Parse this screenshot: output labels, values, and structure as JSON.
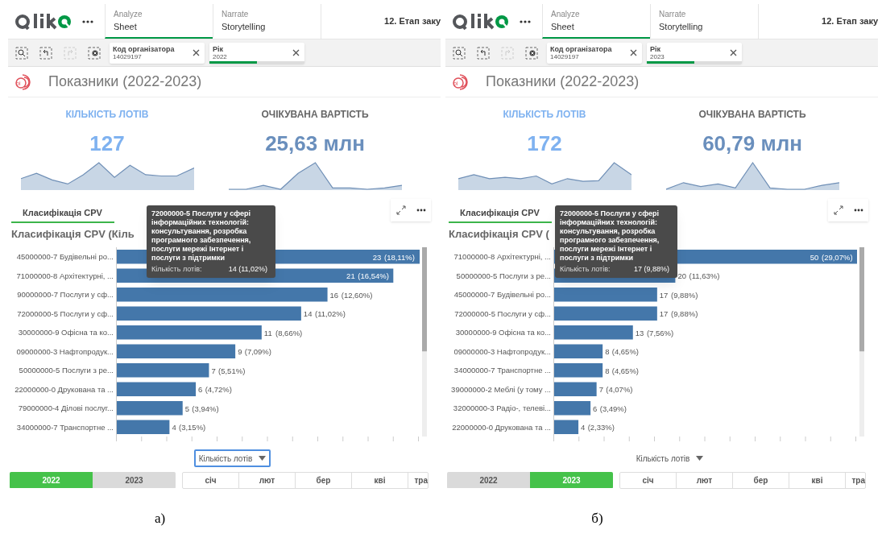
{
  "panels": [
    {
      "nav": {
        "tabs": [
          {
            "label": "Analyze",
            "sub": "Sheet",
            "selected": true
          },
          {
            "label": "Narrate",
            "sub": "Storytelling",
            "selected": false
          }
        ],
        "app_title": "12. Етап заку"
      },
      "filters": [
        {
          "label": "Код організатора",
          "value": "14029197"
        },
        {
          "label": "Рік",
          "value": "2022",
          "level": 0.5
        }
      ],
      "sheet_logo": "bi",
      "sheet_title": "Показники (2022-2023)",
      "kpis": [
        {
          "label": "КІЛЬКІСТЬ ЛОТІВ",
          "value": "127",
          "color": "#7fb2f0"
        },
        {
          "label": "ОЧІКУВАНА ВАРТІСТЬ",
          "value": "25,63 млн",
          "color": "#6a8fbd"
        }
      ],
      "chart_tabs": [
        {
          "label": "Класифікація CPV",
          "selected": true
        }
      ],
      "chart_title": "Класифікація CPV (Кіль",
      "chart_data": {
        "type": "bar",
        "orientation": "horizontal",
        "data_labels": true,
        "categories": [
          "45000000-7 Будівельні ро...",
          "71000000-8 Архітектурні, ...",
          "90000000-7 Послуги у сф...",
          "72000000-5 Послуги у сф...",
          "30000000-9 Офісна та ко...",
          "09000000-3 Нафтопродук...",
          "50000000-5 Послуги з ре...",
          "22000000-0 Друкована та ...",
          "79000000-4 Ділові послуг...",
          "34000000-7 Транспортне ..."
        ],
        "values": [
          23,
          21,
          16,
          14,
          11,
          9,
          7,
          6,
          5,
          4
        ]
      },
      "bar_shares": [
        "(18,11%)",
        "(16,54%)",
        "(12,60%)",
        "(11,02%)",
        "(8,66%)",
        "(7,09%)",
        "(5,51%)",
        "(4,72%)",
        "(3,94%)",
        "(3,15%)"
      ],
      "tooltip": {
        "title": "72000000-5 Послуги у сфері інформаційних технологій: консультування, розробка програмного забезпечення, послуги мережі Інтернет і послуги з підтримки",
        "measure": "Кількість лотів:",
        "value": "14 (11,02%)"
      },
      "measure_select": {
        "label": "Кількість лотів",
        "focused": true
      },
      "years": [
        {
          "label": "2022",
          "selected": true
        },
        {
          "label": "2023",
          "selected": false
        }
      ],
      "months": [
        "січ",
        "лют",
        "бер",
        "кві",
        "тра"
      ],
      "caption": "а)"
    },
    {
      "nav": {
        "tabs": [
          {
            "label": "Analyze",
            "sub": "Sheet",
            "selected": true
          },
          {
            "label": "Narrate",
            "sub": "Storytelling",
            "selected": false
          }
        ],
        "app_title": "12. Етап заку"
      },
      "filters": [
        {
          "label": "Код організатора",
          "value": "14029197"
        },
        {
          "label": "Рік",
          "value": "2023",
          "level": 0.5
        }
      ],
      "sheet_logo": "bi",
      "sheet_title": "Показники (2022-2023)",
      "kpis": [
        {
          "label": "КІЛЬКІСТЬ ЛОТІВ",
          "value": "172",
          "color": "#7fb2f0"
        },
        {
          "label": "ОЧІКУВАНА ВАРТІСТЬ",
          "value": "60,79 млн",
          "color": "#6a8fbd"
        }
      ],
      "chart_tabs": [
        {
          "label": "Класифікація CPV",
          "selected": true
        }
      ],
      "chart_title": "Класифікація CPV (",
      "chart_data": {
        "type": "bar",
        "orientation": "horizontal",
        "data_labels": true,
        "categories": [
          "71000000-8 Архітектурні, ...",
          "50000000-5 Послуги з ре...",
          "45000000-7 Будівельні ро...",
          "72000000-5 Послуги у сф...",
          "30000000-9 Офісна та ко...",
          "09000000-3 Нафтопродук...",
          "34000000-7 Транспортне ...",
          "39000000-2 Меблі (у тому ...",
          "32000000-3 Радіо-, телеві...",
          "22000000-0 Друкована та ..."
        ],
        "values": [
          50,
          20,
          17,
          17,
          13,
          8,
          8,
          7,
          6,
          4
        ]
      },
      "bar_shares": [
        "(29,07%)",
        "(11,63%)",
        "(9,88%)",
        "(9,88%)",
        "(7,56%)",
        "(4,65%)",
        "(4,65%)",
        "(4,07%)",
        "(3,49%)",
        "(2,33%)"
      ],
      "tooltip": {
        "title": "72000000-5 Послуги у сфері інформаційних технологій: консультування, розробка програмного забезпечення, послуги мережі Інтернет і послуги з підтримки",
        "measure": "Кількість лотів:",
        "value": "17 (9,88%)"
      },
      "measure_select": {
        "label": "Кількість лотів",
        "focused": false
      },
      "years": [
        {
          "label": "2022",
          "selected": false
        },
        {
          "label": "2023",
          "selected": true
        }
      ],
      "months": [
        "січ",
        "лют",
        "бер",
        "кві",
        "тра"
      ],
      "caption": "б)"
    }
  ]
}
